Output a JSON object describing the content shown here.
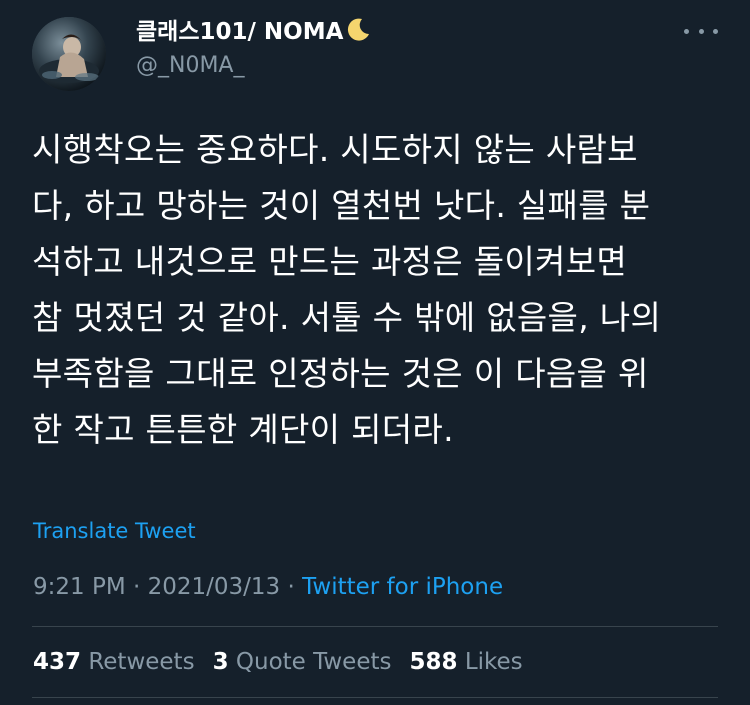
{
  "author": {
    "display_name": "클래스101/ NOMA",
    "handle": "@_N0MA_",
    "badge_icon": "crescent-moon-icon"
  },
  "tweet": {
    "lines": [
      "시행착오는 중요하다. 시도하지 않는 사람보",
      "다, 하고 망하는 것이 열천번 낫다. 실패를 분",
      "석하고 내것으로 만드는 과정은 돌이켜보면",
      "참 멋졌던 것 같아. 서툴 수 밖에 없음을, 나의",
      "부족함을 그대로 인정하는 것은 이 다음을 위",
      "한 작고 튼튼한 계단이 되더라."
    ],
    "translate_label": "Translate Tweet",
    "time": "9:21 PM",
    "separator": "·",
    "date": "2021/03/13",
    "source": "Twitter for iPhone"
  },
  "stats": {
    "retweets_count": "437",
    "retweets_label": "Retweets",
    "quotes_count": "3",
    "quotes_label": "Quote Tweets",
    "likes_count": "588",
    "likes_label": "Likes"
  },
  "colors": {
    "background": "#15202b",
    "text": "#ffffff",
    "secondary": "#8899a6",
    "accent": "#1da1f2",
    "divider": "#38444d"
  }
}
